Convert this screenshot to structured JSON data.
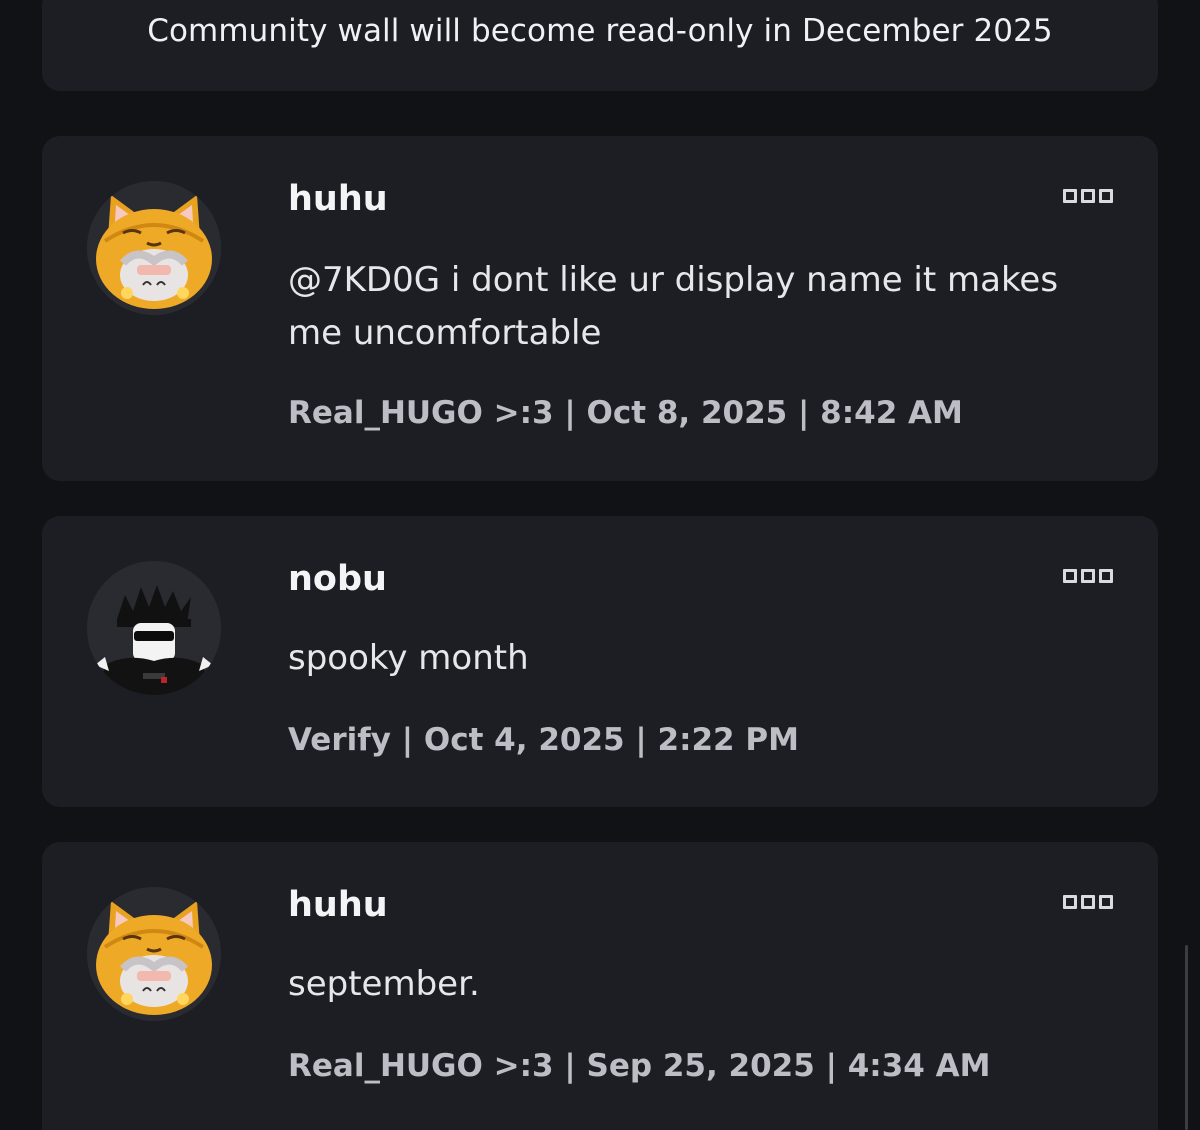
{
  "notice": {
    "text": "Community wall will become read-only in December 2025"
  },
  "posts": [
    {
      "author": "huhu",
      "message": "@7KD0G i dont like ur display name it makes me uncomfortable",
      "meta": "Real_HUGO >:3 | Oct 8, 2025 | 8:42 AM",
      "avatar_icon": "cat-hood-avatar-icon"
    },
    {
      "author": "nobu",
      "message": "spooky month",
      "meta": "Verify | Oct 4, 2025 | 2:22 PM",
      "avatar_icon": "black-outfit-avatar-icon"
    },
    {
      "author": "huhu",
      "message": "september.",
      "meta": "Real_HUGO >:3 | Sep 25, 2025 | 4:34 AM",
      "avatar_icon": "cat-hood-avatar-icon"
    }
  ],
  "colors": {
    "background": "#111216",
    "card": "#1d1e23",
    "primary_text": "#f3f4f6",
    "meta_text": "#bcbec5",
    "avatar_orange": "#e6a020"
  }
}
